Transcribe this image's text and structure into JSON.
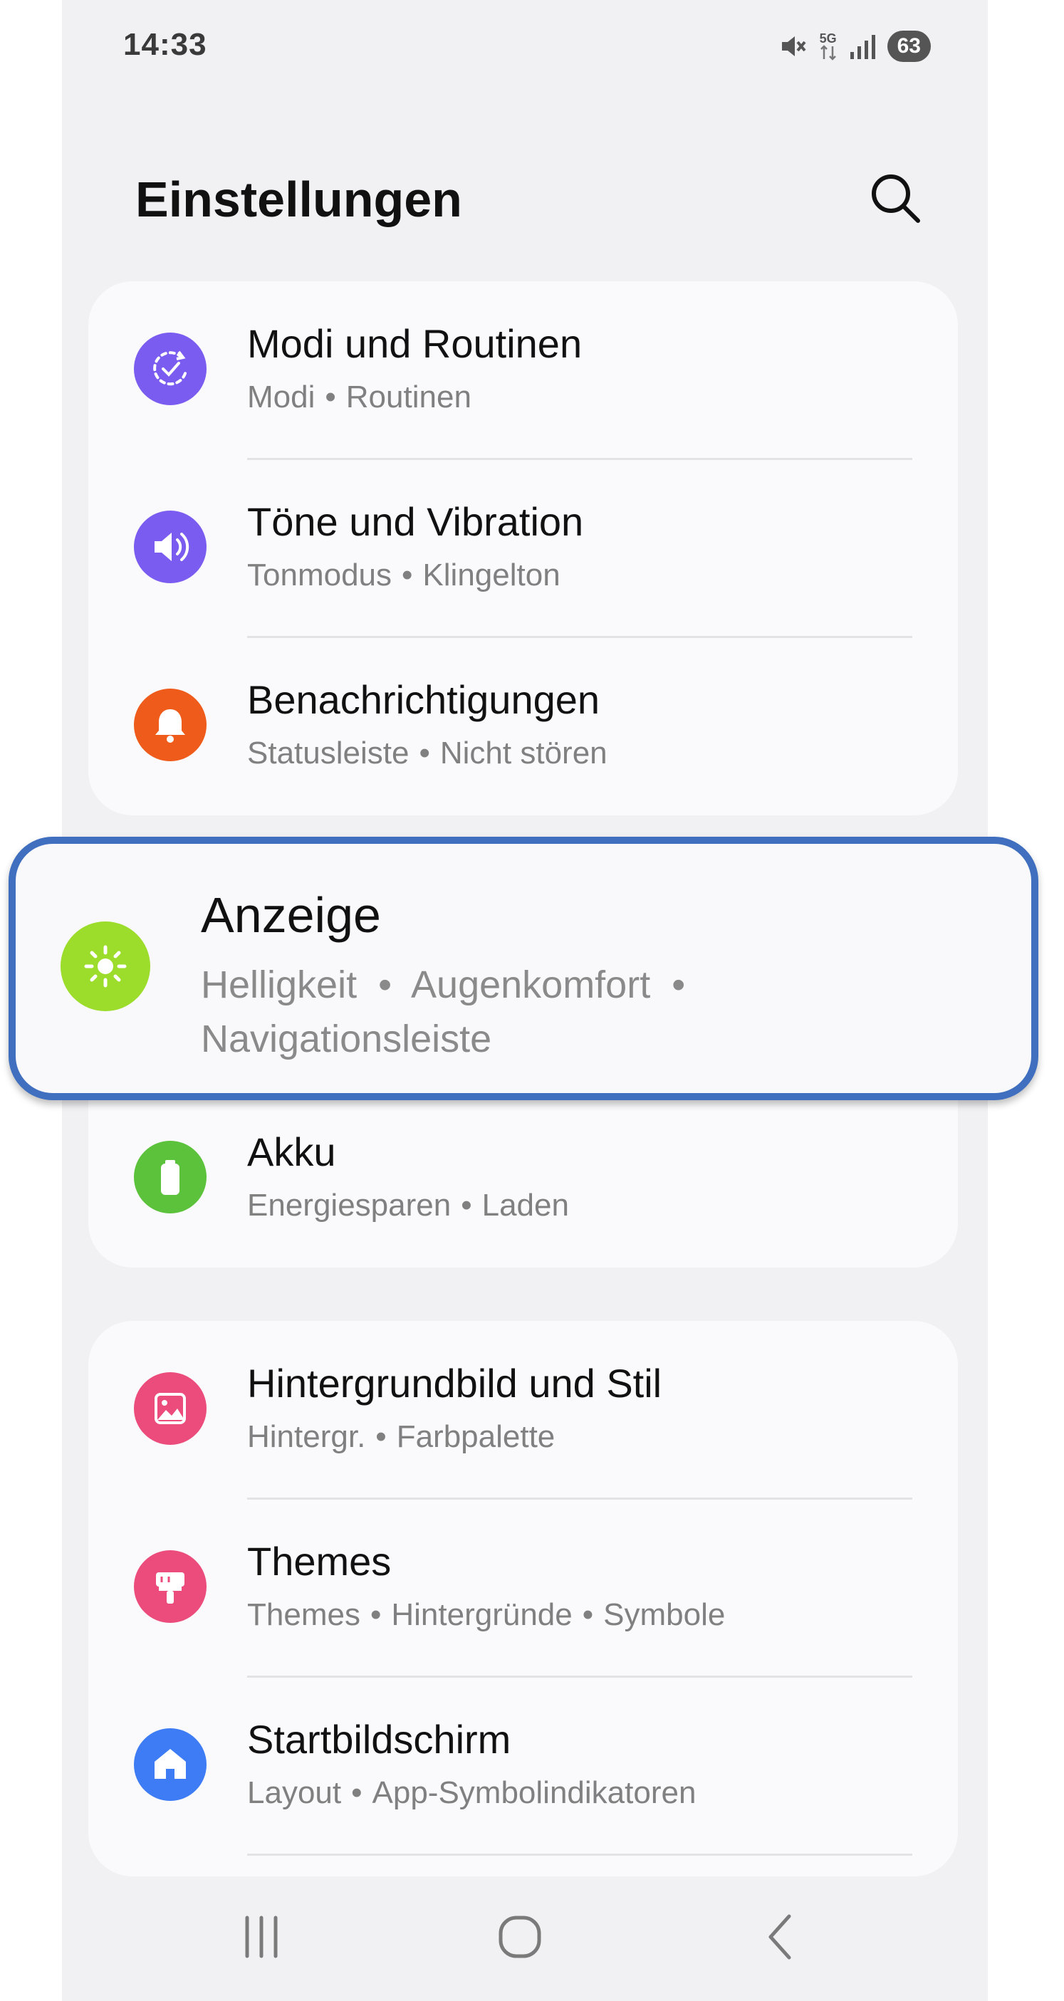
{
  "status_bar": {
    "time": "14:33",
    "network": "5G",
    "battery": "63"
  },
  "header": {
    "title": "Einstellungen"
  },
  "groups": [
    {
      "items": [
        {
          "title": "Modi und Routinen",
          "sub": [
            "Modi",
            "Routinen"
          ],
          "icon": "modes-routines-icon",
          "color": "#7b5cf0"
        },
        {
          "title": "Töne und Vibration",
          "sub": [
            "Tonmodus",
            "Klingelton"
          ],
          "icon": "sound-icon",
          "color": "#7b5cf0"
        },
        {
          "title": "Benachrichtigungen",
          "sub": [
            "Statusleiste",
            "Nicht stören"
          ],
          "icon": "bell-icon",
          "color": "#ee5b1a"
        }
      ]
    },
    {
      "highlighted": {
        "title": "Anzeige",
        "sub_line1": "Helligkeit  •  Augenkomfort  •",
        "sub_line2": "Navigationsleiste",
        "icon": "brightness-icon",
        "color": "#9cdc2a"
      },
      "items": [
        {
          "title": "Akku",
          "sub": [
            "Energiesparen",
            "Laden"
          ],
          "icon": "battery-icon",
          "color": "#5cc23c"
        }
      ]
    },
    {
      "items": [
        {
          "title": "Hintergrundbild und Stil",
          "sub": [
            "Hintergr.",
            "Farbpalette"
          ],
          "icon": "wallpaper-icon",
          "color": "#ec4c7c"
        },
        {
          "title": "Themes",
          "sub": [
            "Themes",
            "Hintergründe",
            "Symbole"
          ],
          "icon": "theme-brush-icon",
          "color": "#ec4c7c"
        },
        {
          "title": "Startbildschirm",
          "sub": [
            "Layout",
            "App-Symbolindikatoren"
          ],
          "icon": "home-icon",
          "color": "#3d7cf4"
        }
      ]
    }
  ]
}
